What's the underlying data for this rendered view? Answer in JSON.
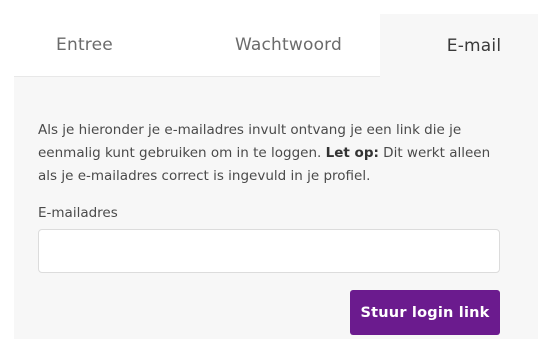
{
  "tabs": {
    "entree": "Entree",
    "wachtwoord": "Wachtwoord",
    "email": "E-mail"
  },
  "panel": {
    "intro_part1": "Als je hieronder je e-mailadres invult ontvang je een link die je eenmalig kunt gebruiken om in te loggen. ",
    "intro_bold": "Let op:",
    "intro_part2": " Dit werkt alleen als je e-mailadres correct is ingevuld in je profiel.",
    "email_label": "E-mailadres",
    "email_value": "",
    "email_placeholder": "",
    "submit_label": "Stuur login link"
  },
  "colors": {
    "accent": "#6b1b8e",
    "panel_bg": "#f7f7f7"
  }
}
